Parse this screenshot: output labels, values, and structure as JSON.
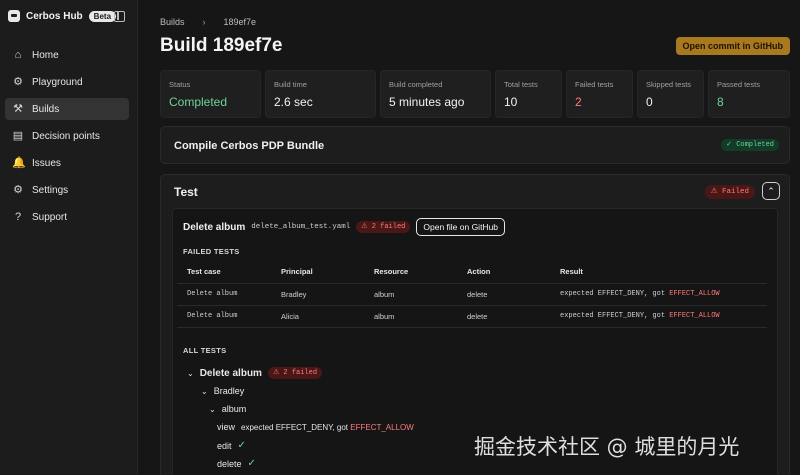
{
  "brand": {
    "name": "Cerbos Hub",
    "badge": "Beta"
  },
  "sidebar": {
    "items": [
      {
        "label": "Home",
        "icon": "home-icon",
        "glyph": "⌂"
      },
      {
        "label": "Playground",
        "icon": "playground-icon",
        "glyph": "⚙"
      },
      {
        "label": "Builds",
        "icon": "builds-icon",
        "glyph": "⚒"
      },
      {
        "label": "Decision points",
        "icon": "decision-points-icon",
        "glyph": "▤"
      },
      {
        "label": "Issues",
        "icon": "issues-icon",
        "glyph": "🔔"
      },
      {
        "label": "Settings",
        "icon": "settings-icon",
        "glyph": "⚙"
      },
      {
        "label": "Support",
        "icon": "support-icon",
        "glyph": "?"
      }
    ],
    "active": "Builds"
  },
  "breadcrumb": {
    "items": [
      "Builds",
      "189ef7e"
    ],
    "separator": "›"
  },
  "page": {
    "title": "Build 189ef7e",
    "open_commit_label": "Open commit in GitHub"
  },
  "stats": [
    {
      "label": "Status",
      "value": "Completed",
      "color": "#6fd39a"
    },
    {
      "label": "Build time",
      "value": "2.6 sec"
    },
    {
      "label": "Build completed",
      "value": "5 minutes ago"
    },
    {
      "label": "Total tests",
      "value": "10"
    },
    {
      "label": "Failed tests",
      "value": "2",
      "color": "#ff7a7a"
    },
    {
      "label": "Skipped tests",
      "value": "0"
    },
    {
      "label": "Passed tests",
      "value": "8",
      "color": "#6fd39a"
    }
  ],
  "compile": {
    "title": "Compile Cerbos PDP Bundle",
    "badge": "✓ Completed"
  },
  "test": {
    "title": "Test",
    "badge": "⚠ Failed",
    "file": {
      "name": "Delete album",
      "path": "delete_album_test.yaml",
      "badge": "⚠ 2 failed",
      "open_label": "Open file on GitHub"
    },
    "failed_section_title": "FAILED TESTS",
    "table": {
      "headers": [
        "Test case",
        "Principal",
        "Resource",
        "Action",
        "Result"
      ],
      "rows": [
        {
          "test_case": "Delete album",
          "principal": "Bradley",
          "resource": "album",
          "action": "delete",
          "result_prefix": "expected EFFECT_DENY, got ",
          "result_effect": "EFFECT_ALLOW"
        },
        {
          "test_case": "Delete album",
          "principal": "Alicia",
          "resource": "album",
          "action": "delete",
          "result_prefix": "expected EFFECT_DENY, got ",
          "result_effect": "EFFECT_ALLOW"
        }
      ]
    },
    "all_section_title": "ALL TESTS",
    "tree": {
      "suite": "Delete album",
      "suite_badge": "⚠ 2 failed",
      "principal": "Bradley",
      "resource": "album",
      "actions": [
        {
          "name": "view",
          "result_prefix": "expected EFFECT_DENY, got ",
          "result_effect": "EFFECT_ALLOW",
          "passed": false
        },
        {
          "name": "edit",
          "passed": true
        },
        {
          "name": "delete",
          "passed": true
        }
      ]
    }
  },
  "watermark": "掘金技术社区 @ 城里的月光"
}
